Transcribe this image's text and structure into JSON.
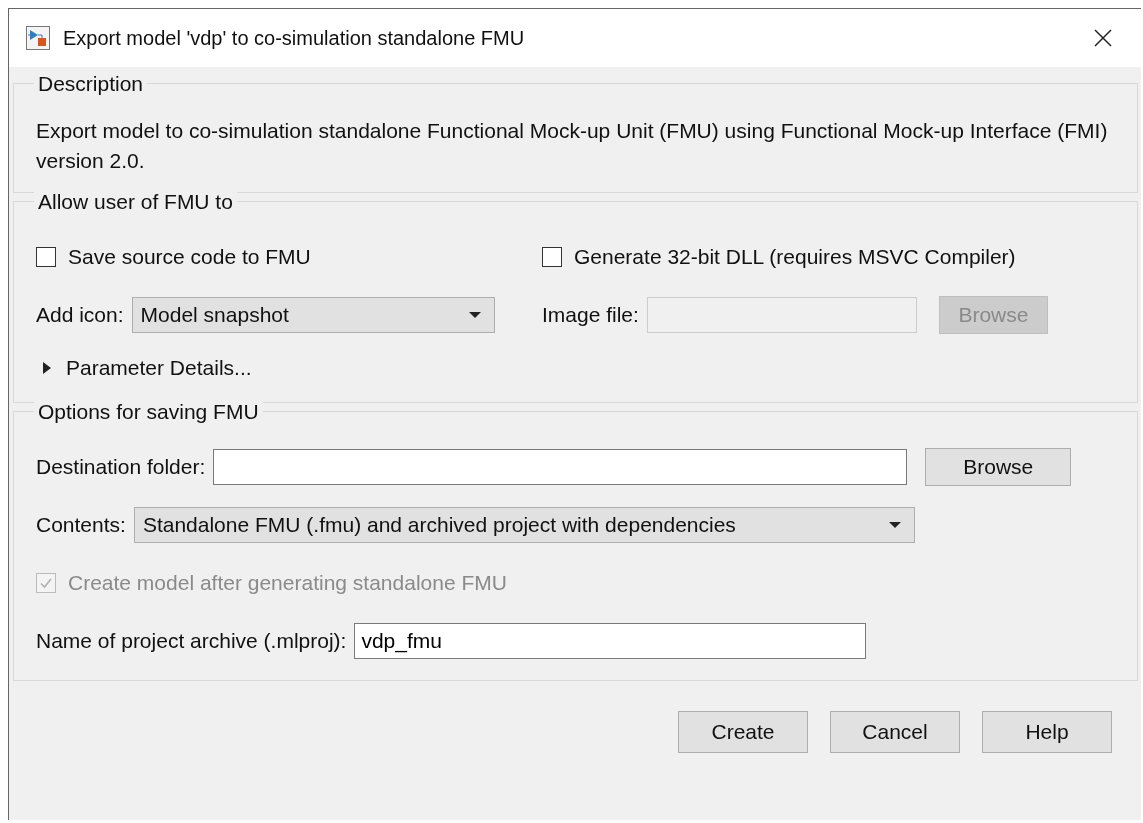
{
  "window": {
    "title": "Export model 'vdp' to co-simulation standalone FMU"
  },
  "description": {
    "heading": "Description",
    "text": "Export model to co-simulation standalone Functional Mock-up Unit (FMU) using Functional Mock-up Interface (FMI) version 2.0."
  },
  "allow_group": {
    "heading": "Allow user of FMU to",
    "checkboxes": [
      {
        "label": "Save source code to FMU",
        "checked": false,
        "disabled": false
      },
      {
        "label": "Generate 32-bit DLL (requires MSVC Compiler)",
        "checked": false,
        "disabled": false
      }
    ],
    "add_icon": {
      "label": "Add icon:",
      "value": "Model snapshot"
    },
    "image_file": {
      "label": "Image file:",
      "disabled": true
    },
    "browse_button": {
      "label": "Browse",
      "disabled": true
    },
    "parameter_details": {
      "label": "Parameter Details...",
      "expanded": false
    }
  },
  "saving_group": {
    "heading": "Options for saving FMU",
    "destination": {
      "label": "Destination folder:"
    },
    "browse_button": {
      "label": "Browse",
      "disabled": false
    },
    "contents": {
      "label": "Contents:",
      "value": "Standalone FMU (.fmu) and archived project with dependencies"
    },
    "create_model": {
      "label": "Create model after generating standalone FMU",
      "checked": true,
      "disabled": true
    },
    "archive_name": {
      "label": "Name of project archive (.mlproj):",
      "value": "vdp_fmu"
    }
  },
  "buttons": [
    {
      "label": "Create"
    },
    {
      "label": "Cancel"
    },
    {
      "label": "Help"
    }
  ]
}
